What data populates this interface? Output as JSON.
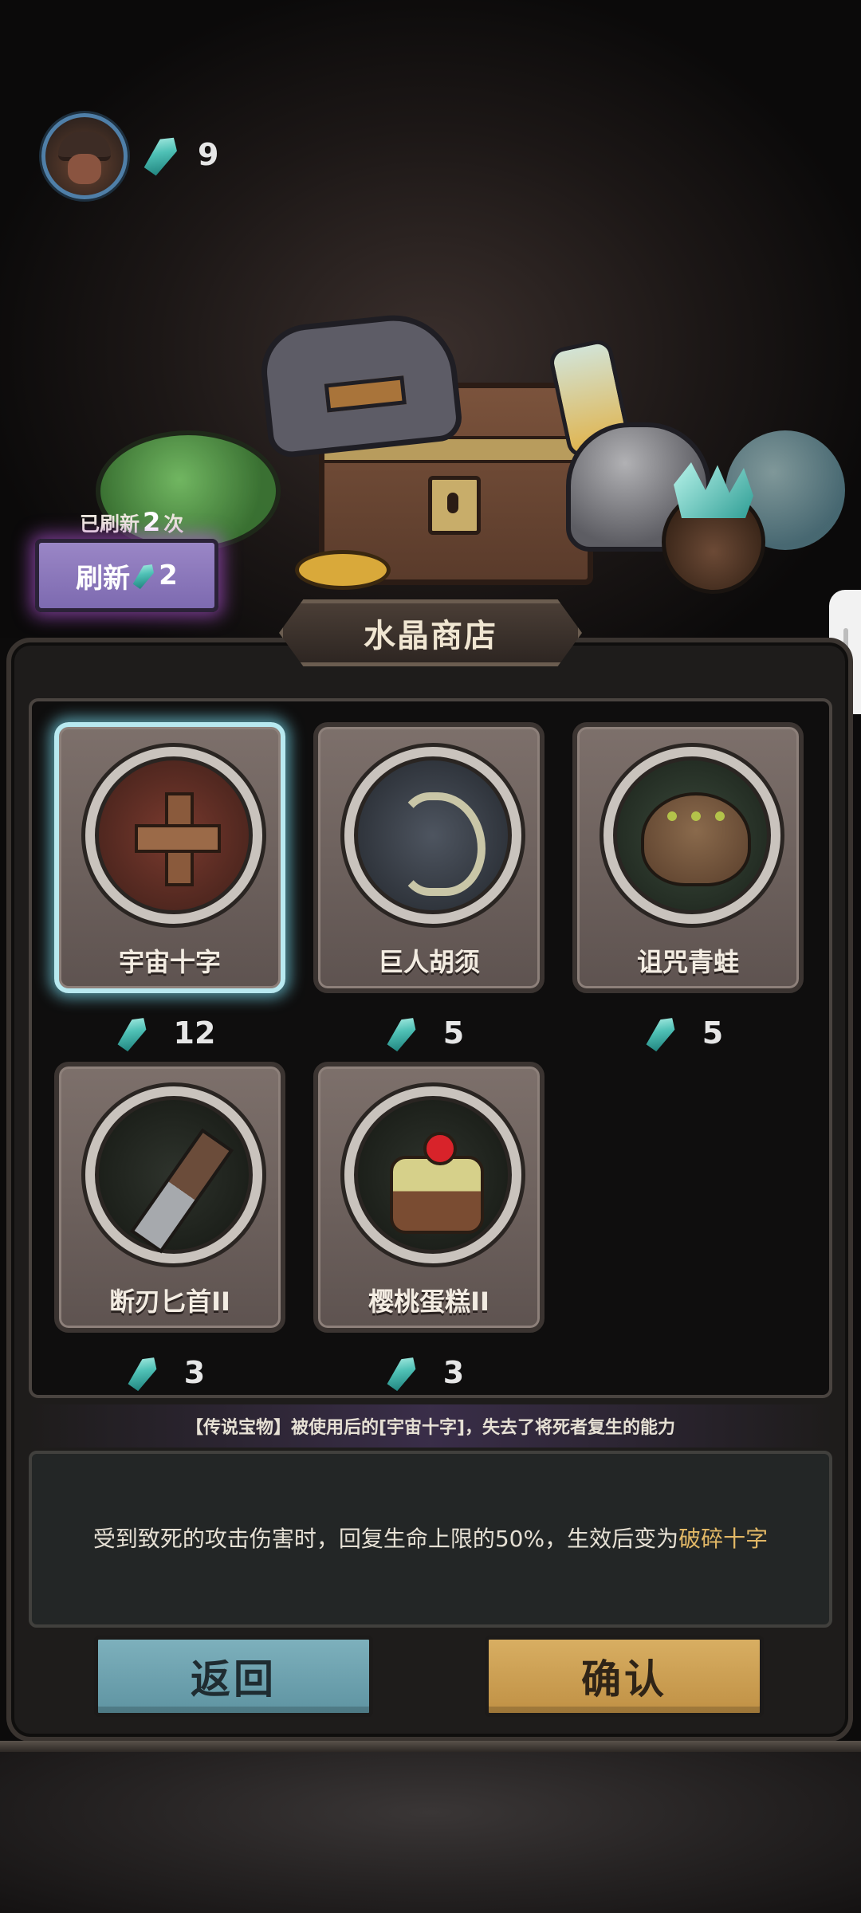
{
  "hud": {
    "crystal_count": "9",
    "avatar": "hero-portrait",
    "crystal_icon": "crystal-icon"
  },
  "refresh": {
    "count_prefix": "已刷新",
    "count_value": "2",
    "count_suffix": "次",
    "button_label": "刷新",
    "button_cost": "2"
  },
  "shop": {
    "title": "水晶商店",
    "items": [
      {
        "name": "宇宙十字",
        "price": "12",
        "icon": "cosmic-cross-icon",
        "selected": true
      },
      {
        "name": "巨人胡须",
        "price": "5",
        "icon": "giant-beard-icon",
        "selected": false
      },
      {
        "name": "诅咒青蛙",
        "price": "5",
        "icon": "cursed-frog-icon",
        "selected": false
      },
      {
        "name": "断刃匕首II",
        "price": "3",
        "icon": "broken-dagger-icon",
        "selected": false
      },
      {
        "name": "樱桃蛋糕II",
        "price": "3",
        "icon": "cherry-cake-icon",
        "selected": false
      }
    ]
  },
  "legend_text": "【传说宝物】被使用后的[宇宙十字]，失去了将死者复生的能力",
  "description": {
    "text": "受到致死的攻击伤害时，回复生命上限的50%，生效后变为",
    "highlight": "破碎十字"
  },
  "buttons": {
    "back": "返回",
    "confirm": "确认"
  },
  "colors": {
    "accent_crystal": "#4fc1b6",
    "confirm": "#c09145",
    "back": "#5f94a2",
    "refresh": "#7d6ab0",
    "highlight": "#e2b866"
  }
}
